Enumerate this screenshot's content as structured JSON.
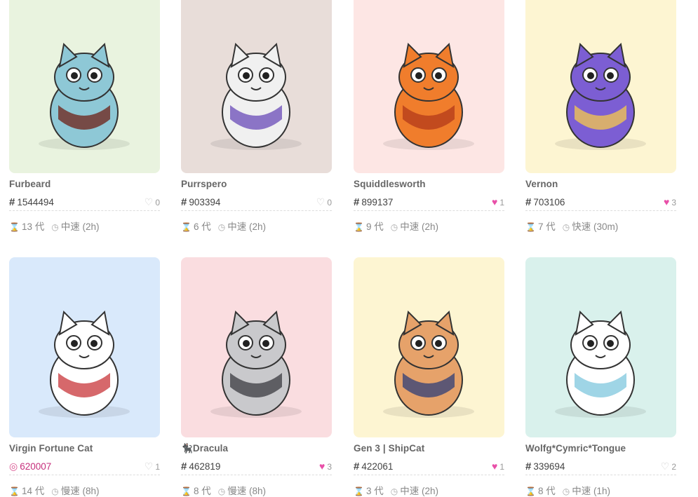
{
  "cards": [
    {
      "name": "Furbeard",
      "id": "1544494",
      "likes": "0",
      "liked": false,
      "gen": "13 代",
      "speed": "中速 (2h)",
      "bg": "#e9f3df",
      "fur": "#8ec8d6",
      "accent": "#6d2016"
    },
    {
      "name": "Purrspero",
      "id": "903394",
      "likes": "0",
      "liked": false,
      "gen": "6 代",
      "speed": "中速 (2h)",
      "bg": "#e8ddd9",
      "fur": "#f0f0f0",
      "accent": "#6a4bb8"
    },
    {
      "name": "Squiddlesworth",
      "id": "899137",
      "likes": "1",
      "liked": true,
      "gen": "9 代",
      "speed": "中速 (2h)",
      "bg": "#fde6e4",
      "fur": "#f07d2c",
      "accent": "#b33a1a"
    },
    {
      "name": "Vernon",
      "id": "703106",
      "likes": "3",
      "liked": true,
      "gen": "7 代",
      "speed": "快速 (30m)",
      "bg": "#fdf5d2",
      "fur": "#7c5ed3",
      "accent": "#f7c94c"
    },
    {
      "name": "Virgin Fortune Cat",
      "id": "620007",
      "likes": "1",
      "liked": false,
      "gen": "14 代",
      "speed": "慢速 (8h)",
      "bg": "#d9e9fb",
      "fur": "#ffffff",
      "accent": "#c8353a",
      "fancy": true
    },
    {
      "name": "Dracula",
      "id": "462819",
      "likes": "3",
      "liked": true,
      "gen": "8 代",
      "speed": "慢速 (8h)",
      "bg": "#fadde0",
      "fur": "#c9c9cc",
      "accent": "#3a3a40",
      "badge": true
    },
    {
      "name": "Gen 3 | ShipCat",
      "id": "422061",
      "likes": "1",
      "liked": true,
      "gen": "3 代",
      "speed": "中速 (2h)",
      "bg": "#fdf5d2",
      "fur": "#e6a26a",
      "accent": "#2f3d78"
    },
    {
      "name": "Wolfg*Cymric*Tongue",
      "id": "339694",
      "likes": "2",
      "liked": false,
      "gen": "8 代",
      "speed": "中速 (1h)",
      "bg": "#d9f1ec",
      "fur": "#ffffff",
      "accent": "#7fc7dd"
    }
  ]
}
